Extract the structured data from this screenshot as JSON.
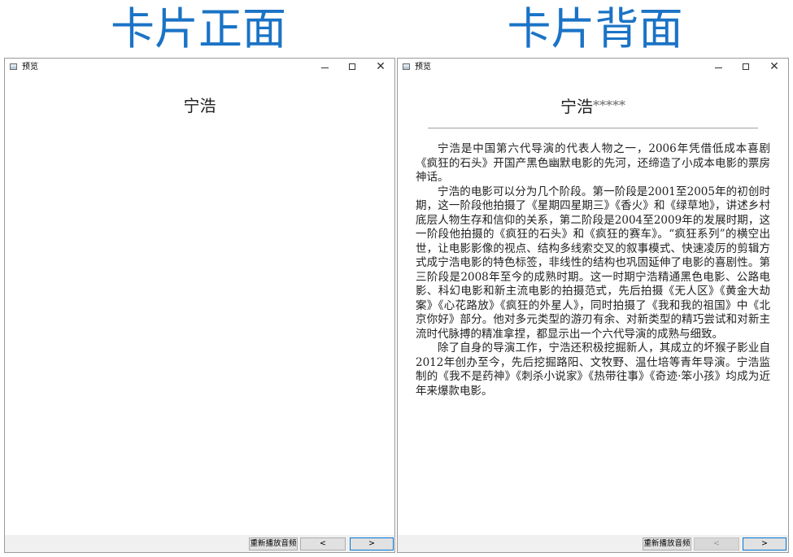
{
  "headlines": {
    "front": "卡片正面",
    "back": "卡片背面"
  },
  "colors": {
    "headline": "#1a73c6",
    "next_button_border": "#0078d7"
  },
  "window_front": {
    "title": "预览",
    "app_icon": "window-icon",
    "controls": {
      "minimize_icon": "minimize-icon",
      "maximize_icon": "maximize-icon",
      "close_icon": "close-icon",
      "minimize_glyph": "—",
      "close_glyph": "✕"
    },
    "card_name": "宁浩",
    "buttons": {
      "replay": "重新播放音频",
      "prev": "<",
      "next": ">"
    }
  },
  "window_back": {
    "title": "预览",
    "app_icon": "window-icon",
    "controls": {
      "minimize_icon": "minimize-icon",
      "maximize_icon": "maximize-icon",
      "close_icon": "close-icon",
      "close_glyph": "✕"
    },
    "card_name": "宁浩",
    "stars": "*****",
    "bio": [
      "宁浩是中国第六代导演的代表人物之一，2006年凭借低成本喜剧《疯狂的石头》开国产黑色幽默电影的先河，还缔造了小成本电影的票房神话。",
      "宁浩的电影可以分为几个阶段。第一阶段是2001至2005年的初创时期，这一阶段他拍摄了《星期四星期三》《香火》和《绿草地》，讲述乡村底层人物生存和信仰的关系，第二阶段是2004至2009年的发展时期，这一阶段他拍摄的《疯狂的石头》和《疯狂的赛车》。“疯狂系列”的横空出世，让电影影像的视点、结构多线索交叉的叙事模式、快速凌厉的剪辑方式成宁浩电影的特色标签，非线性的结构也巩固延伸了电影的喜剧性。第三阶段是2008年至今的成熟时期。这一时期宁浩精通黑色电影、公路电影、科幻电影和新主流电影的拍摄范式，先后拍摄《无人区》《黄金大劫案》《心花路放》《疯狂的外星人》，同时拍摄了《我和我的祖国》中《北京你好》部分。他对多元类型的游刃有余、对新类型的精巧尝试和对新主流时代脉搏的精准拿捏，都显示出一个六代导演的成熟与细致。",
      "除了自身的导演工作，宁浩还积极挖掘新人，其成立的坏猴子影业自2012年创办至今，先后挖掘路阳、文牧野、温仕培等青年导演。宁浩监制的《我不是药神》《刺杀小说家》《热带往事》《奇迹·笨小孩》均成为近年来爆款电影。"
    ],
    "buttons": {
      "replay": "重新播放音频",
      "prev": "<",
      "next": ">"
    }
  }
}
